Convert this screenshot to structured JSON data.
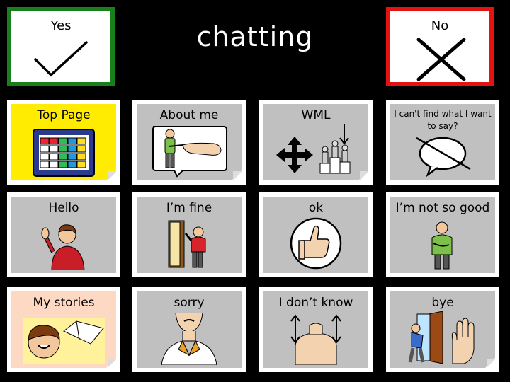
{
  "title": "chatting",
  "yes": {
    "label": "Yes",
    "icon": "checkmark-icon",
    "border": "#17801a"
  },
  "no": {
    "label": "No",
    "icon": "cross-icon",
    "border": "#e31313"
  },
  "cells": [
    {
      "id": "top-page",
      "label": "Top Page",
      "icon": "grid-board-icon",
      "bg": "#ffec00"
    },
    {
      "id": "about-me",
      "label": "About me",
      "icon": "person-pointing-icon",
      "bg": "#c0c0c0"
    },
    {
      "id": "wml",
      "label": "WML",
      "icon": "podium-arrows-icon",
      "bg": "#c0c0c0"
    },
    {
      "id": "cant-find",
      "label": "I can't find what I want to say?",
      "icon": "crossed-speech-bubble-icon",
      "bg": "#c0c0c0"
    },
    {
      "id": "hello",
      "label": "Hello",
      "icon": "person-waving-icon",
      "bg": "#c0c0c0"
    },
    {
      "id": "im-fine",
      "label": "I’m fine",
      "icon": "person-at-door-icon",
      "bg": "#c0c0c0"
    },
    {
      "id": "ok",
      "label": "ok",
      "icon": "thumbs-up-icon",
      "bg": "#c0c0c0"
    },
    {
      "id": "not-so-good",
      "label": "I’m not so good",
      "icon": "person-unwell-icon",
      "bg": "#c0c0c0"
    },
    {
      "id": "my-stories",
      "label": "My stories",
      "icon": "person-with-book-icon",
      "bg": "#fdd9c4"
    },
    {
      "id": "sorry",
      "label": "sorry",
      "icon": "sorry-face-icon",
      "bg": "#c0c0c0"
    },
    {
      "id": "dont-know",
      "label": "I don’t know",
      "icon": "shrug-icon",
      "bg": "#c0c0c0"
    },
    {
      "id": "bye",
      "label": "bye",
      "icon": "person-leaving-wave-icon",
      "bg": "#c0c0c0"
    }
  ]
}
